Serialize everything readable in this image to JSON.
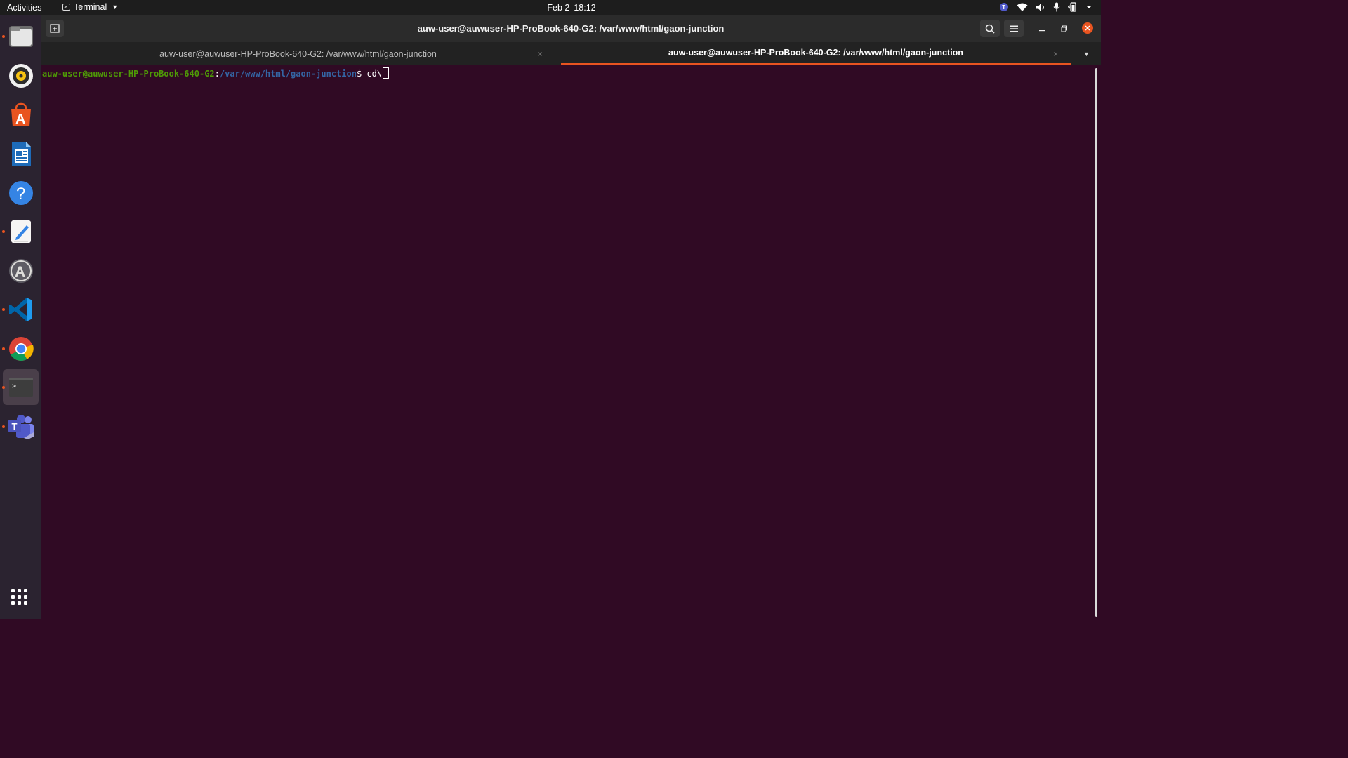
{
  "topbar": {
    "activities": "Activities",
    "app_menu_label": "Terminal",
    "date": "Feb 2",
    "time": "18:12",
    "tray_icons": [
      "teams-tray-icon",
      "wifi-icon",
      "volume-icon",
      "microphone-icon",
      "battery-icon",
      "system-menu-caret"
    ]
  },
  "dock": {
    "items": [
      {
        "name": "files",
        "running": true
      },
      {
        "name": "rhythmbox",
        "running": false
      },
      {
        "name": "ubuntu-software",
        "running": false
      },
      {
        "name": "libreoffice-writer",
        "running": false
      },
      {
        "name": "help",
        "running": false
      },
      {
        "name": "text-editor",
        "running": true
      },
      {
        "name": "software-updater",
        "running": false
      },
      {
        "name": "vscode",
        "running": true
      },
      {
        "name": "chrome",
        "running": true
      },
      {
        "name": "terminal",
        "running": true,
        "active": true
      },
      {
        "name": "teams",
        "running": true
      }
    ],
    "show_apps": "apps-grid-icon"
  },
  "window": {
    "title": "auw-user@auwuser-HP-ProBook-640-G2: /var/www/html/gaon-junction",
    "tabs": [
      {
        "label": "auw-user@auwuser-HP-ProBook-640-G2: /var/www/html/gaon-junction",
        "active": false
      },
      {
        "label": "auw-user@auwuser-HP-ProBook-640-G2: /var/www/html/gaon-junction",
        "active": true
      }
    ],
    "tab_close_glyph": "×"
  },
  "terminal": {
    "prompt_user": "auw-user@auwuser-HP-ProBook-640-G2",
    "prompt_sep": ":",
    "prompt_path": "/var/www/html/gaon-junction",
    "prompt_symbol": "$ ",
    "command": "cd\\"
  },
  "colors": {
    "terminal_bg": "#300a24",
    "accent": "#e95420",
    "prompt_user": "#4e9a06",
    "prompt_path": "#3465a4"
  }
}
